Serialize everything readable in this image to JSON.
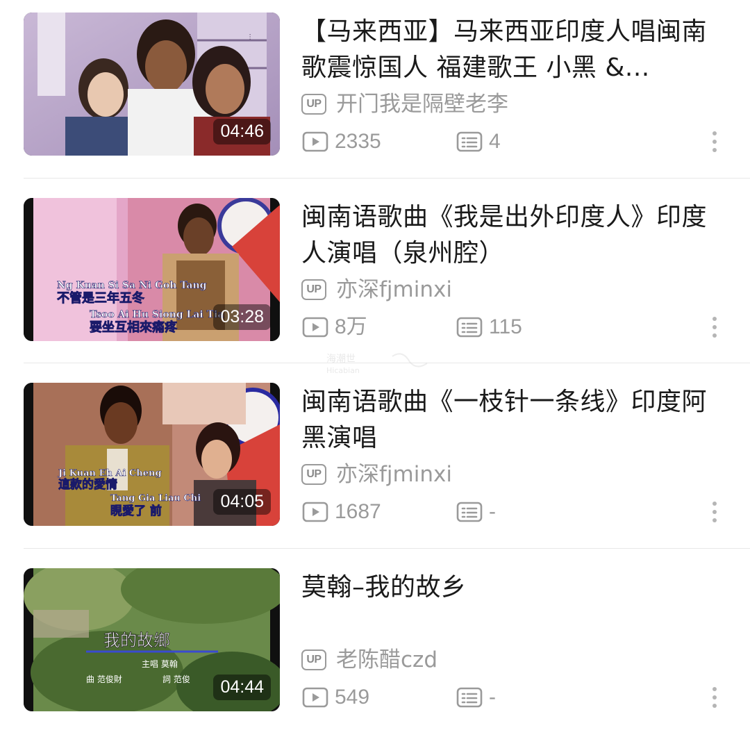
{
  "colors": {
    "text_primary": "#1a1a1a",
    "text_secondary": "#9a9a9a",
    "divider": "#e8e8e8",
    "duration_bg": "rgba(0,0,0,0.45)"
  },
  "videos": [
    {
      "title": "【马来西亚】马来西亚印度人唱闽南歌震惊国人  福建歌王  小黑  &...",
      "up_badge": "UP",
      "uploader": "开门我是隔壁老李",
      "duration": "04:46",
      "plays": "2335",
      "comments": "4",
      "play_icon": "play-icon",
      "comment_icon": "danmaku-icon",
      "more_icon": "more-vertical-icon"
    },
    {
      "title": "闽南语歌曲《我是出外印度人》印度人演唱（泉州腔）",
      "up_badge": "UP",
      "uploader": "亦深fjminxi",
      "duration": "03:28",
      "plays": "8万",
      "comments": "115",
      "play_icon": "play-icon",
      "comment_icon": "danmaku-icon",
      "more_icon": "more-vertical-icon",
      "subtitle_lines": [
        "Ng Kuan Si Sa Ni Goh Tang",
        "不管是三年五冬",
        "Tsoo Ai Hu Siong Lai Tia",
        "要坐互相來痛疼"
      ]
    },
    {
      "title": "闽南语歌曲《一枝针一条线》印度阿黑演唱",
      "up_badge": "UP",
      "uploader": "亦深fjminxi",
      "duration": "04:05",
      "plays": "1687",
      "comments": "-",
      "play_icon": "play-icon",
      "comment_icon": "danmaku-icon",
      "more_icon": "more-vertical-icon",
      "subtitle_lines": [
        "Ji Kuan Eh Ai Cheng",
        "這款的愛情",
        "Tang Gia Liau Chi",
        "睍愛了  前"
      ]
    },
    {
      "title": "莫翰–我的故乡",
      "up_badge": "UP",
      "uploader": "老陈醋czd",
      "duration": "04:44",
      "plays": "549",
      "comments": "-",
      "play_icon": "play-icon",
      "comment_icon": "danmaku-icon",
      "more_icon": "more-vertical-icon",
      "subtitle_lines": [
        "我的故鄉",
        "主唱 莫翰",
        "曲 范俊財",
        "詞 范俊"
      ]
    }
  ],
  "watermark": {
    "line1": "海潮世",
    "line2": "Hicabian"
  }
}
